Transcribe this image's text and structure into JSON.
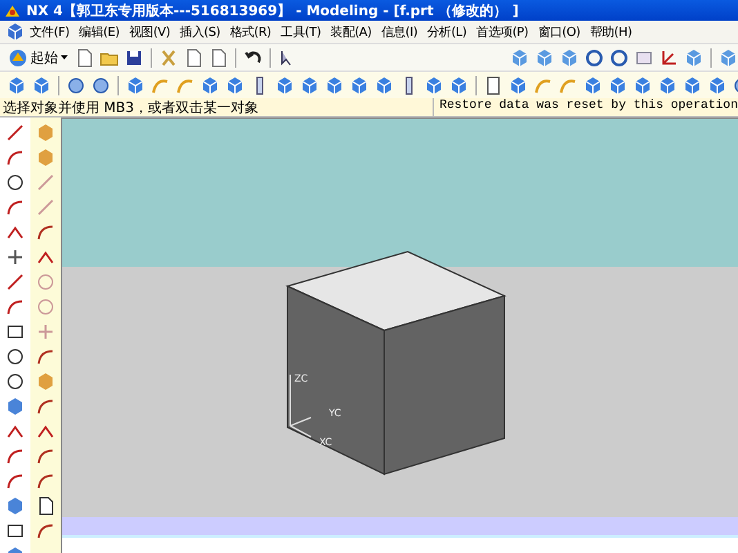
{
  "window": {
    "title": "NX 4【郭卫东专用版本---516813969】 - Modeling - [f.prt （修改的） ]"
  },
  "menu": [
    "文件(F)",
    "编辑(E)",
    "视图(V)",
    "插入(S)",
    "格式(R)",
    "工具(T)",
    "装配(A)",
    "信息(I)",
    "分析(L)",
    "首选项(P)",
    "窗口(O)",
    "帮助(H)"
  ],
  "toolbar": {
    "start_label": "起始"
  },
  "status_bar": {
    "prompt": "选择对象并使用 MB3，或者双击某一对象",
    "message": "Restore data was reset by this operation"
  },
  "viewport": {
    "axis_labels": [
      "ZC",
      "YC",
      "XC"
    ]
  }
}
